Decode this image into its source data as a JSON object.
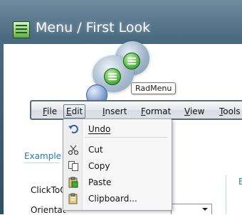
{
  "window": {
    "title": "Menu / First Look"
  },
  "tooltip": "RadMenu",
  "menu_bar": {
    "items": [
      {
        "label": "File",
        "accel": "F",
        "rest": "ile"
      },
      {
        "label": "Edit",
        "accel": "E",
        "rest": "dit"
      },
      {
        "label": "Insert",
        "accel": "I",
        "rest": "nsert"
      },
      {
        "label": "Format",
        "accel": "F",
        "rest": "ormat"
      },
      {
        "label": "View",
        "accel": "V",
        "rest": "iew"
      },
      {
        "label": "Tools",
        "accel": "T",
        "rest": "ools"
      }
    ],
    "open_item": "Edit"
  },
  "edit_menu": {
    "items": [
      {
        "label": "Undo",
        "icon": "undo-icon"
      },
      {
        "label": "Cut",
        "icon": "scissors-icon"
      },
      {
        "label": "Copy",
        "icon": "copy-icon"
      },
      {
        "label": "Paste",
        "icon": "paste-icon"
      },
      {
        "label": "Clipboard...",
        "icon": "clipboard-icon"
      }
    ]
  },
  "background": {
    "example_label": "Example",
    "click_label": "ClickToO",
    "orientation_label": "Orientat",
    "right_label": "E"
  },
  "colors": {
    "accent_blue": "#2a78b9",
    "title_text": "#ffffff",
    "menu_border": "#5f6a79"
  }
}
